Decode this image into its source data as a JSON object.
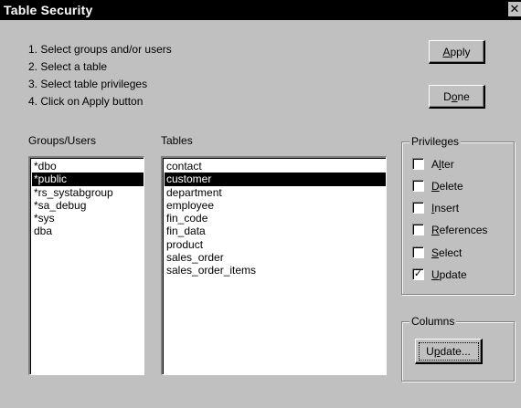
{
  "window": {
    "title": "Table Security",
    "close_symbol": "✕"
  },
  "instructions": [
    "1. Select groups and/or users",
    "2. Select a table",
    "3. Select table privileges",
    "4. Click on Apply button"
  ],
  "buttons": {
    "apply": {
      "pre": "",
      "key": "A",
      "post": "pply"
    },
    "done": {
      "pre": "D",
      "key": "o",
      "post": "ne"
    }
  },
  "groups_users": {
    "label": "Groups/Users",
    "items": [
      "*dbo",
      "*public",
      "*rs_systabgroup",
      "*sa_debug",
      "*sys",
      "dba"
    ],
    "selected": "*public"
  },
  "tables": {
    "label": "Tables",
    "items": [
      "contact",
      "customer",
      "department",
      "employee",
      "fin_code",
      "fin_data",
      "product",
      "sales_order",
      "sales_order_items"
    ],
    "selected": "customer"
  },
  "privileges": {
    "title": "Privileges",
    "items": [
      {
        "pre": "A",
        "key": "l",
        "post": "ter",
        "checked": false
      },
      {
        "pre": "",
        "key": "D",
        "post": "elete",
        "checked": false
      },
      {
        "pre": "",
        "key": "I",
        "post": "nsert",
        "checked": false
      },
      {
        "pre": "",
        "key": "R",
        "post": "eferences",
        "checked": false
      },
      {
        "pre": "",
        "key": "S",
        "post": "elect",
        "checked": false
      },
      {
        "pre": "",
        "key": "U",
        "post": "pdate",
        "checked": true
      }
    ],
    "check_symbol": "✓"
  },
  "columns": {
    "title": "Columns",
    "update_button": {
      "pre": "U",
      "key": "p",
      "post": "date..."
    }
  }
}
